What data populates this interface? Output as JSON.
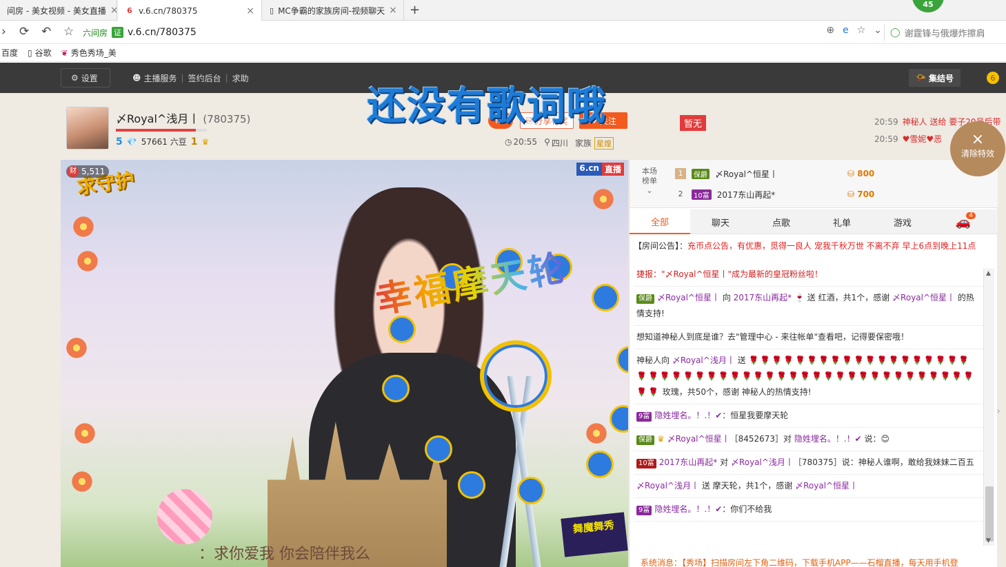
{
  "browser": {
    "tabs": [
      {
        "label": "间房 - 美女视频 - 美女直播",
        "icon": "page-icon",
        "active": false
      },
      {
        "label": "v.6.cn/780375",
        "icon": "six-logo-icon",
        "active": true
      },
      {
        "label": "MC争霸的家族房间-视频聊天",
        "icon": "page-icon",
        "active": false
      }
    ],
    "new_tab": "+",
    "badge": "45",
    "url_site_tag": "六间房",
    "url_cert": "证",
    "url": "v.6.cn/780375",
    "search_text": "谢霆锋与俄爆炸擦肩",
    "bookmarks": [
      {
        "label": "百度"
      },
      {
        "label": "谷歌"
      },
      {
        "label": "秀色秀场_美"
      }
    ]
  },
  "site": {
    "settings_label": "设置",
    "anchor_service": "主播服务",
    "sign_backend": "签约后台",
    "help": "求助",
    "gather": "集结号",
    "coin": "6",
    "lyric_overlay": "还没有歌词哦"
  },
  "host": {
    "name": "〆Royal^浅月丨",
    "id": "(780375)",
    "level_num": "5",
    "beans": "57661 六豆",
    "crown_num": "1",
    "share_label": "分享有奖",
    "follow_label": "关注",
    "small_btn": "h5",
    "time": "20:55",
    "location": "四川",
    "family_label": "家族",
    "family_tag": "星煌",
    "pause_label": "暂无",
    "progress": 0.88
  },
  "feed": [
    {
      "time": "20:59",
      "user": "神秘人",
      "text": "送给 要子20号后带"
    },
    {
      "time": "20:59",
      "user": "♥雪妮♥恶",
      "text": ""
    }
  ],
  "clear_effects": {
    "icon": "×",
    "label": "清除特效"
  },
  "video": {
    "wealth_tag": "财",
    "wealth_value": "5,511",
    "guard_text": "求守护",
    "brand_a": "6.cn",
    "brand_b": "直播",
    "gift_word": "幸福摩天轮",
    "subtitle": "：求你爱我  你会陪伴我么",
    "dance_label": "舞魔舞秀"
  },
  "rank": {
    "title": "本场榜单",
    "rows": [
      {
        "no": "1",
        "badge": "保爵",
        "name": "〆Royal^恒星丨",
        "value": "800"
      },
      {
        "no": "2",
        "badge": "10富",
        "name": "2017东山再起*",
        "value": "700"
      }
    ]
  },
  "chat_tabs": [
    "全部",
    "聊天",
    "点歌",
    "礼单",
    "游戏"
  ],
  "car_count": "4",
  "notice": {
    "prefix": "【房间公告】：",
    "text": "充币点公告，有优惠，觅得一良人 宠我千秋万世 不离不弃 早上6点到晚上11点"
  },
  "messages": [
    {
      "parts": [
        "捷报：\"〆Royal^恒星丨\"成为最新的皇冠粉丝啦！"
      ]
    },
    {
      "badge": "保爵",
      "user": "〆Royal^恒星丨",
      "text": " 向 ",
      "user2": "2017东山再起*",
      "text2": " 送 红酒，共1个，感谢 ",
      "user3": "〆Royal^恒星丨",
      "text3": " 的热情支持!"
    },
    {
      "plain": "想知道神秘人到底是谁？去\"管理中心 - 来往帐单\"查看吧，记得要保密哦！"
    },
    {
      "user": "神秘人向 ",
      "user2": "〆Royal^浅月丨",
      "text": " 送 ",
      "roses": "🌹🌹🌹🌹🌹🌹🌹🌹🌹🌹🌹🌹🌹🌹🌹🌹🌹🌹🌹🌹🌹🌹🌹🌹🌹🌹🌹🌹🌹🌹🌹🌹🌹🌹🌹🌹🌹🌹🌹🌹🌹🌹🌹🌹🌹🌹🌹🌹🌹🌹",
      "text2": " 玫瑰，共50个，感谢 神秘人的热情支持!"
    },
    {
      "badge": "9富",
      "user": "隐姓埋名。！.！✔",
      "text": "：恒星我要摩天轮"
    },
    {
      "badge": "保爵",
      "user": "〆Royal^恒星丨",
      "text": "［8452673］对 ",
      "user2": "隐姓埋名。！.！✔",
      "text2": " 说："
    },
    {
      "badge": "10富",
      "user": "2017东山再起*",
      "text": " 对 ",
      "user2": "〆Royal^浅月丨",
      "text2": "［780375］说：神秘人谁啊，敢给我妹妹二百五"
    },
    {
      "user": "〆Royal^浅月丨",
      "text": " 送 摩天轮，共1个，感谢 ",
      "user2": "〆Royal^恒星丨"
    },
    {
      "badge": "9富",
      "user": "隐姓埋名。！.！✔",
      "text": "：你们不给我"
    }
  ],
  "system_msg": "系统消息：【秀场】扫描房间左下角二维码，下载手机APP——石榴直播，每天用手机登",
  "colors": {
    "accent": "#f25a1e",
    "lyric": "#1e7bd6",
    "dark_bar": "#3a3a3a"
  }
}
